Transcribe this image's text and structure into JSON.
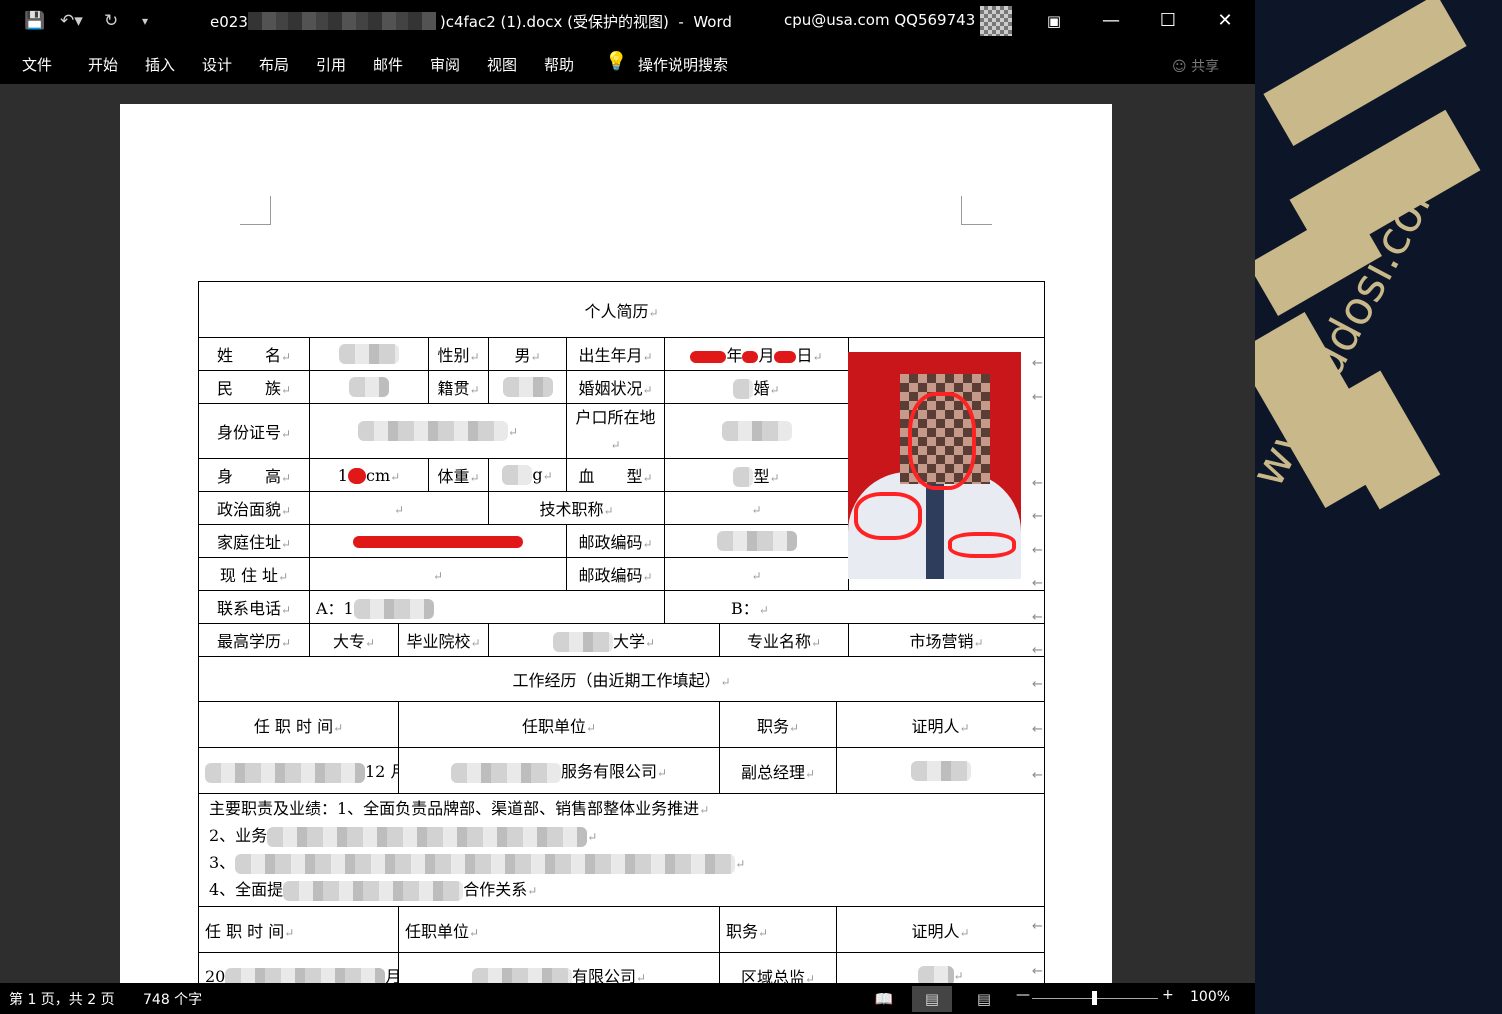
{
  "titlebar": {
    "doc_title_start": "e023",
    "doc_title_end": ")c4fac2 (1).docx (受保护的视图)  -  Word",
    "account": "cpu@usa.com QQ569743",
    "quick_access": [
      "save",
      "undo",
      "redo",
      "customize"
    ],
    "window_controls": [
      "ribbon-display-options",
      "minimize",
      "maximize",
      "close"
    ]
  },
  "ribbon": {
    "tabs": [
      "文件",
      "开始",
      "插入",
      "设计",
      "布局",
      "引用",
      "邮件",
      "审阅",
      "视图",
      "帮助"
    ],
    "tell_me": "操作说明搜索",
    "share": "共享"
  },
  "resume": {
    "title": "个人简历",
    "name_label": "姓　　名",
    "gender_label": "性别",
    "gender_value": "男",
    "birth_label": "出生年月",
    "birth_value": [
      "年",
      "月",
      "日"
    ],
    "ethnic_label": "民　　族",
    "native_label": "籍贯",
    "marital_label": "婚姻状况",
    "marital_value": "婚",
    "id_label": "身份证号",
    "hukou_label": "户口所在地",
    "height_label": "身　　高",
    "height_value": "cm",
    "weight_label": "体重",
    "weight_value": "g",
    "blood_label": "血　　型",
    "blood_value": "型",
    "politics_label": "政治面貌",
    "tech_title_label": "技术职称",
    "home_addr_label": "家庭住址",
    "zip_label": "邮政编码",
    "current_addr_label": "现 住 址",
    "phone_label": "联系电话",
    "phone_a": "A：1",
    "phone_b": "B：",
    "edu_label": "最高学历",
    "edu_value": "大专",
    "school_label": "毕业院校",
    "school_value": "大学",
    "major_label": "专业名称",
    "major_value": "市场营销",
    "work_header": "工作经历（由近期工作填起）",
    "work_cols": [
      "任 职 时 间",
      "任职单位",
      "职务",
      "证明人"
    ],
    "job1": {
      "time": "12 月",
      "company": "服务有限公司",
      "position": "副总经理"
    },
    "duties": [
      "主要职责及业绩：1、全面负责品牌部、渠道部、销售部整体业务推进",
      "2、业务",
      "3、",
      "4、全面提",
      "合作关系"
    ],
    "job2": {
      "time_prefix": "20",
      "time_suffix": "月",
      "company": "有限公司",
      "position": "区域总监"
    }
  },
  "status": {
    "pages": "第 1 页，共 2 页",
    "words": "748 个字",
    "zoom": "100%",
    "zoom_level": 0.5
  },
  "desktop": {
    "watermark": "www.ddosi.com"
  }
}
